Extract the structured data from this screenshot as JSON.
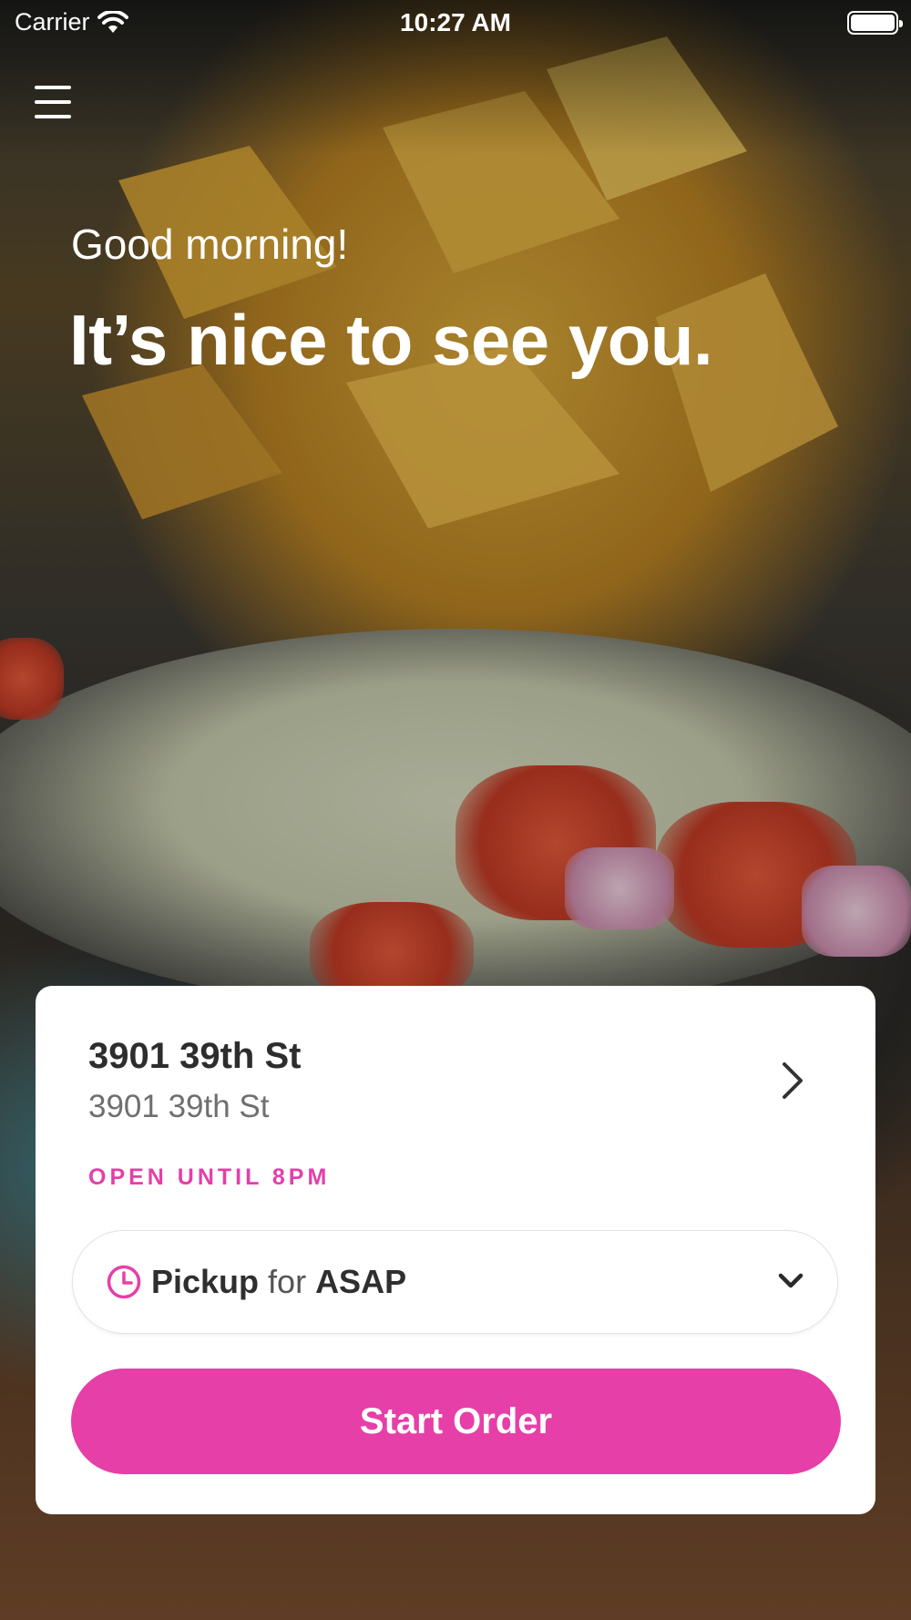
{
  "status_bar": {
    "carrier": "Carrier",
    "time": "10:27 AM",
    "wifi_icon": "wifi-icon",
    "battery_icon": "battery-icon"
  },
  "header": {
    "menu_icon": "hamburger-menu-icon",
    "greeting": "Good morning!",
    "headline": "It’s nice to see you."
  },
  "location": {
    "name": "3901 39th St",
    "address": "3901 39th St",
    "open_status": "OPEN UNTIL 8PM",
    "chevron_icon": "chevron-right-icon"
  },
  "order_mode": {
    "clock_icon": "clock-icon",
    "mode": "Pickup",
    "connector": "for",
    "time": "ASAP",
    "dropdown_icon": "chevron-down-icon"
  },
  "actions": {
    "start_order": "Start Order"
  },
  "colors": {
    "accent": "#E63FA8",
    "open_status": "#E33FA8",
    "card_background": "#FFFFFF",
    "text_primary": "#2D2D2D",
    "text_secondary": "#6F6F6F"
  }
}
